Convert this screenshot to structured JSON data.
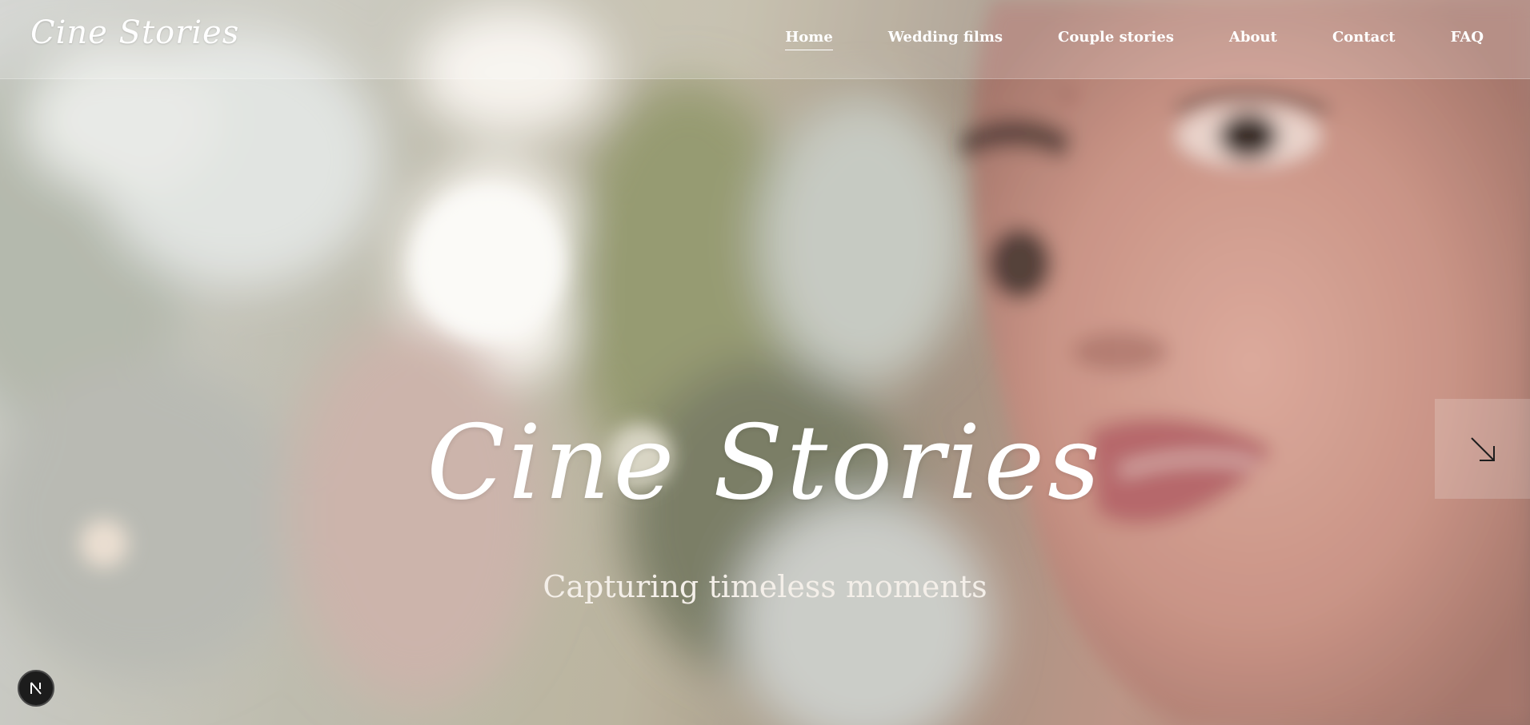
{
  "brand": {
    "logo_text": "Cine Stories"
  },
  "nav": {
    "items": [
      {
        "label": "Home",
        "active": true
      },
      {
        "label": "Wedding films",
        "active": false
      },
      {
        "label": "Couple stories",
        "active": false
      },
      {
        "label": "About",
        "active": false
      },
      {
        "label": "Contact",
        "active": false
      },
      {
        "label": "FAQ",
        "active": false
      }
    ]
  },
  "hero": {
    "title": "Cine Stories",
    "subtitle": "Capturing timeless moments"
  },
  "icons": {
    "scroll_down": "arrow-down-right-icon",
    "dev_badge": "next-js-logo-icon"
  },
  "colors": {
    "text": "#ffffff",
    "badge_bg": "#1c1c1c"
  }
}
